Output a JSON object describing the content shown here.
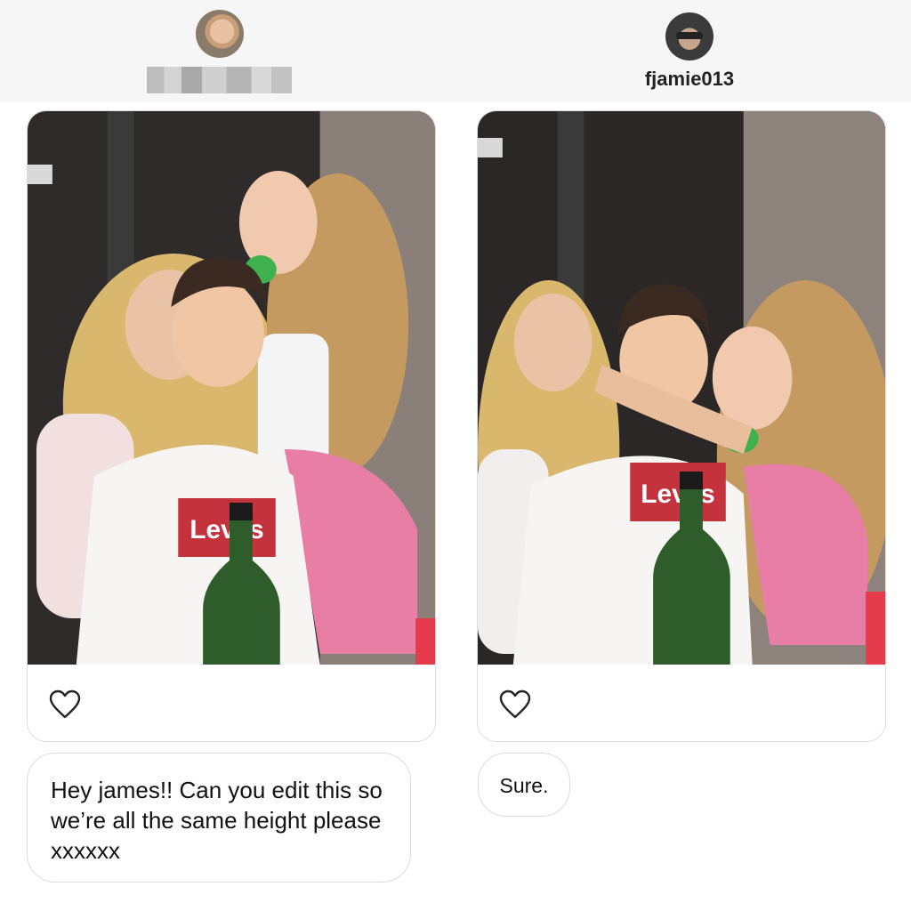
{
  "left_user": {
    "avatar_icon": "profile-photo-avatar",
    "username_redacted": true
  },
  "right_user": {
    "avatar_icon": "profile-photo-avatar",
    "username": "fjamie013"
  },
  "left_post": {
    "image_description_icon": "group-photo",
    "shirt_text": "Levi's",
    "like_icon": "heart-outline-icon"
  },
  "right_post": {
    "image_description_icon": "edited-group-photo",
    "shirt_text": "Levi's",
    "like_icon": "heart-outline-icon"
  },
  "messages": [
    {
      "sender": "left",
      "text": "Hey james!! Can you edit this so we’re all the same height please xxxxxx"
    },
    {
      "sender": "right",
      "text": "Sure."
    }
  ],
  "colors": {
    "background": "#ffffff",
    "header_band": "#f6f6f6",
    "bubble_border": "#dcdcdc",
    "text": "#111111"
  }
}
